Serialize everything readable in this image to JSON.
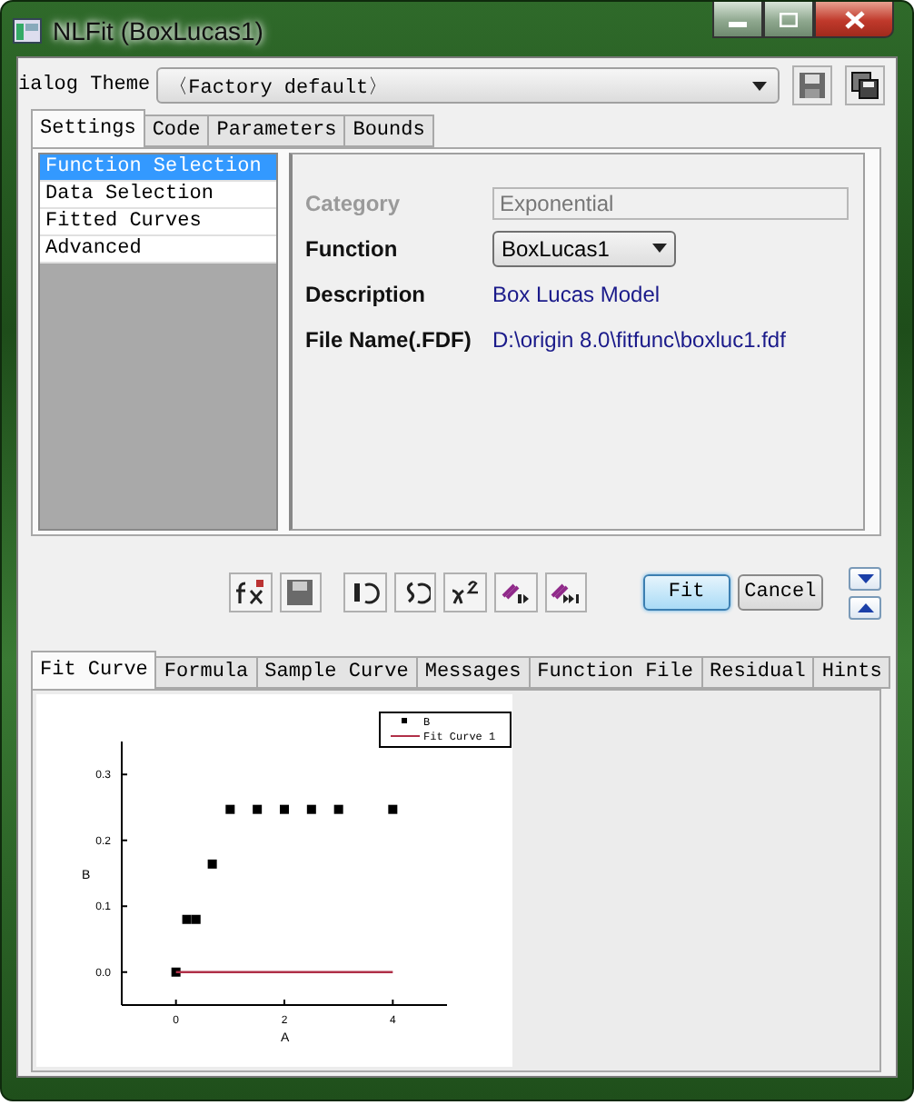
{
  "window": {
    "title": "NLFit (BoxLucas1)"
  },
  "dialog_theme": {
    "label": "ialog Theme",
    "value": "〈Factory default〉"
  },
  "top_tabs": [
    {
      "label": "Settings",
      "selected": true
    },
    {
      "label": "Code",
      "selected": false
    },
    {
      "label": "Parameters",
      "selected": false
    },
    {
      "label": "Bounds",
      "selected": false
    }
  ],
  "sections": [
    {
      "label": "Function Selection",
      "selected": true
    },
    {
      "label": "Data Selection",
      "selected": false
    },
    {
      "label": "Fitted Curves",
      "selected": false
    },
    {
      "label": "Advanced",
      "selected": false
    }
  ],
  "fields": [
    {
      "label": "Category",
      "value": "Exponential",
      "kind": "field",
      "disabled": true
    },
    {
      "label": "Function",
      "value": "BoxLucas1",
      "kind": "dropdown",
      "disabled": false
    },
    {
      "label": "Description",
      "value": "Box Lucas Model",
      "kind": "text",
      "disabled": false
    },
    {
      "label": "File Name(.FDF)",
      "value": "D:\\origin 8.0\\fitfunc\\boxluc1.fdf",
      "kind": "text",
      "disabled": false
    }
  ],
  "buttons": [
    {
      "label": "Fit",
      "kind": "default"
    },
    {
      "label": "Cancel",
      "kind": "normal"
    }
  ],
  "bottom_tabs": [
    {
      "label": "Fit Curve",
      "selected": true
    },
    {
      "label": "Formula",
      "selected": false
    },
    {
      "label": "Sample Curve",
      "selected": false
    },
    {
      "label": "Messages",
      "selected": false
    },
    {
      "label": "Function File",
      "selected": false
    },
    {
      "label": "Residual",
      "selected": false
    },
    {
      "label": "Hints",
      "selected": false
    }
  ],
  "chart_data": {
    "type": "scatter",
    "xlabel": "A",
    "ylabel": "B",
    "x": [
      0,
      0.2,
      0.37,
      0.67,
      1,
      1.5,
      2,
      2.5,
      3,
      4
    ],
    "series": [
      {
        "name": "B",
        "color": "#000000",
        "values": [
          0,
          0.08,
          0.08,
          0.164,
          0.247,
          0.247,
          0.247,
          0.247,
          0.247,
          0.247
        ]
      },
      {
        "name": "Fit Curve 1",
        "color": "#b03048",
        "type": "line",
        "values": [
          0,
          0,
          0,
          0,
          0,
          0,
          0,
          0,
          0,
          0
        ]
      }
    ],
    "legend": true,
    "xlim": [
      -1,
      5
    ],
    "ylim": [
      -0.05,
      0.35
    ],
    "xticks": [
      0,
      2,
      4
    ],
    "yticks": [
      {
        "value": 0,
        "label": "0.0"
      },
      {
        "value": 0.1,
        "label": "0.1"
      },
      {
        "value": 0.2,
        "label": "0.2"
      },
      {
        "value": 0.3,
        "label": "0.3"
      }
    ]
  }
}
